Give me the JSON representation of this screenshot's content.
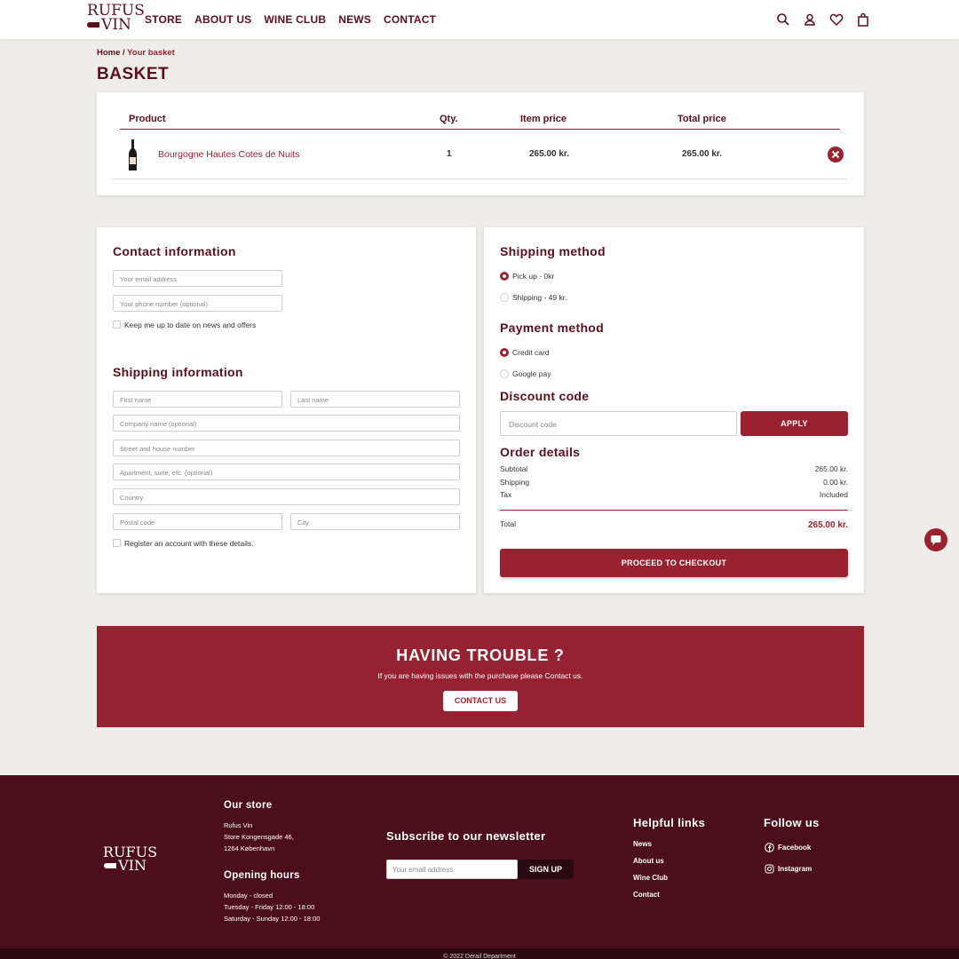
{
  "brand": {
    "line1": "RUFUS",
    "line2": "VIN"
  },
  "nav": [
    "STORE",
    "ABOUT US",
    "WINE CLUB",
    "NEWS",
    "CONTACT"
  ],
  "header_icons": [
    "search-icon",
    "user-icon",
    "heart-icon",
    "bag-icon"
  ],
  "breadcrumb": {
    "home": "Home",
    "sep": " / ",
    "current": "Your basket"
  },
  "page_title": "BASKET",
  "basket": {
    "headers": {
      "product": "Product",
      "qty": "Qty.",
      "item_price": "Item price",
      "total_price": "Total price"
    },
    "items": [
      {
        "name": "Bourgogne Hautes Cotes de Nuits",
        "qty": "1",
        "item_price": "265.00 kr.",
        "total_price": "265.00 kr."
      }
    ]
  },
  "contact": {
    "title": "Contact information",
    "email_ph": "Your email address",
    "phone_ph": "Your phone number (optional)",
    "newsletter_label": "Keep me up to date on news and offers"
  },
  "shipping_info": {
    "title": "Shipping information",
    "first_ph": "First name",
    "last_ph": "Last name",
    "company_ph": "Company name (optional)",
    "street_ph": "Street and house number",
    "apt_ph": "Apartment, suite, etc. (optional)",
    "country_ph": "Country",
    "postal_ph": "Postal code",
    "city_ph": "City",
    "register_label": "Register an account with these details."
  },
  "shipping_method": {
    "title": "Shipping method",
    "options": [
      "Pick up - 0kr",
      "Shipping - 49 kr."
    ],
    "selected": 0
  },
  "payment_method": {
    "title": "Payment method",
    "options": [
      "Credit card",
      "Google pay"
    ],
    "selected": 0
  },
  "discount": {
    "title": "Discount code",
    "placeholder": "Discount code",
    "apply": "APPLY"
  },
  "order": {
    "title": "Order details",
    "subtotal_label": "Subtotal",
    "subtotal": "265.00 kr.",
    "shipping_label": "Shipping",
    "shipping": "0.00 kr.",
    "tax_label": "Tax",
    "tax": "Included",
    "total_label": "Total",
    "total": "265.00 kr.",
    "checkout": "PROCEED TO CHECKOUT"
  },
  "trouble": {
    "title": "HAVING TROUBLE ?",
    "text": "If you are having issues with the purchase please Contact us.",
    "button": "CONTACT US"
  },
  "footer": {
    "store_title": "Our store",
    "store_lines": [
      "Rufus Vin",
      "Store Kongensgade 46,",
      "1264 København"
    ],
    "hours_title": "Opening hours",
    "hours_lines": [
      "Monday - closed",
      "Tuesday - Friday 12:00 - 18:00",
      "Saturday - Sunday 12:00 - 18:00"
    ],
    "newsletter_title": "Subscribe to our newsletter",
    "newsletter_ph": "Your email address",
    "signup": "SIGN UP",
    "helpful_title": "Helpful links",
    "helpful": [
      "News",
      "About us",
      "Wine Club",
      "Contact"
    ],
    "follow_title": "Follow us",
    "social": [
      "Facebook",
      "Instagram"
    ],
    "copyright": "© 2022 Derail Department"
  },
  "colors": {
    "brand_dark": "#5a0f1c",
    "accent": "#9a2230",
    "footer": "#4b0e1a",
    "bg": "#efede9"
  }
}
